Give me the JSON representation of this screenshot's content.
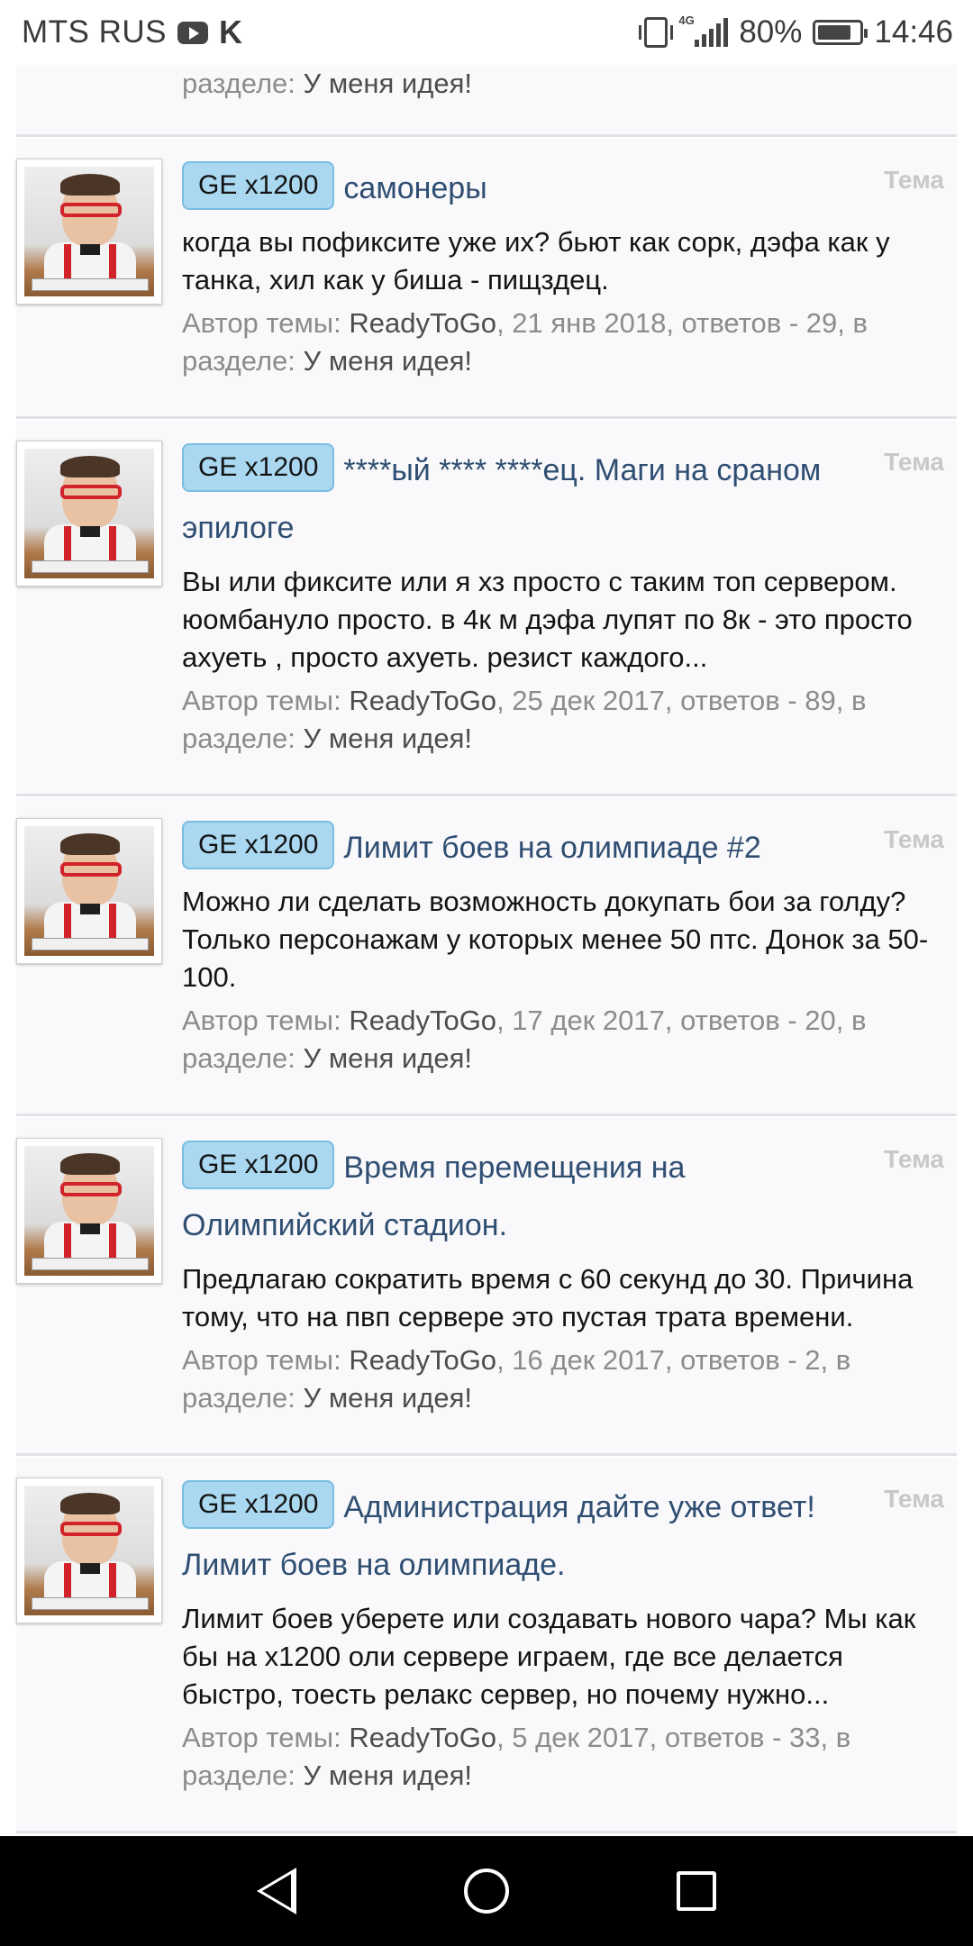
{
  "status_bar": {
    "carrier": "MTS RUS",
    "network": "4G",
    "battery": "80%",
    "battery_level": 0.8,
    "time": "14:46"
  },
  "labels": {
    "author": "Автор темы:",
    "section": "разделе:"
  },
  "prev_result": {
    "section": "У меня идея!"
  },
  "results": [
    {
      "prefix": "GE x1200",
      "title": "самонеры",
      "type": "Тема",
      "snippet": "когда вы пофиксите уже их? бьют как сорк, дэфа как у танка, хил как у биша - пищздец.",
      "author": "ReadyToGo",
      "meta_tail": ", 21 янв 2018, ответов - 29, в",
      "section": "У меня идея!"
    },
    {
      "prefix": "GE x1200",
      "title": "****ый **** ****ец. Маги на сраном эпилоге",
      "type": "Тема",
      "snippet": "Вы или фиксите или я хз просто с таким топ сервером. юомбануло просто. в 4к м дэфа лупят по 8к - это просто ахуеть , просто ахуеть. резист каждого...",
      "author": "ReadyToGo",
      "meta_tail": ", 25 дек 2017, ответов - 89, в",
      "section": "У меня идея!"
    },
    {
      "prefix": "GE x1200",
      "title": "Лимит боев на олимпиаде #2",
      "type": "Тема",
      "snippet": "Можно ли сделать возможность докупать бои за голду? Только персонажам у которых менее 50 птс. Донок за 50-100.",
      "author": "ReadyToGo",
      "meta_tail": ", 17 дек 2017, ответов - 20, в",
      "section": "У меня идея!"
    },
    {
      "prefix": "GE x1200",
      "title": "Время перемещения на Олимпийский стадион.",
      "type": "Тема",
      "snippet": "Предлагаю сократить время с 60 секунд до 30. Причина тому, что на пвп сервере это пустая трата времени.",
      "author": "ReadyToGo",
      "meta_tail": ", 16 дек 2017, ответов - 2, в",
      "section": "У меня идея!"
    },
    {
      "prefix": "GE x1200",
      "title": "Администрация дайте уже ответ! Лимит боев на олимпиаде.",
      "type": "Тема",
      "snippet": "Лимит боев уберете или создавать нового чара? Мы как бы на x1200 оли сервере играем, где все делается быстро, тоесть релакс сервер, но почему нужно...",
      "author": "ReadyToGo",
      "meta_tail": ", 5 дек 2017, ответов - 33, в",
      "section": "У меня идея!"
    }
  ]
}
